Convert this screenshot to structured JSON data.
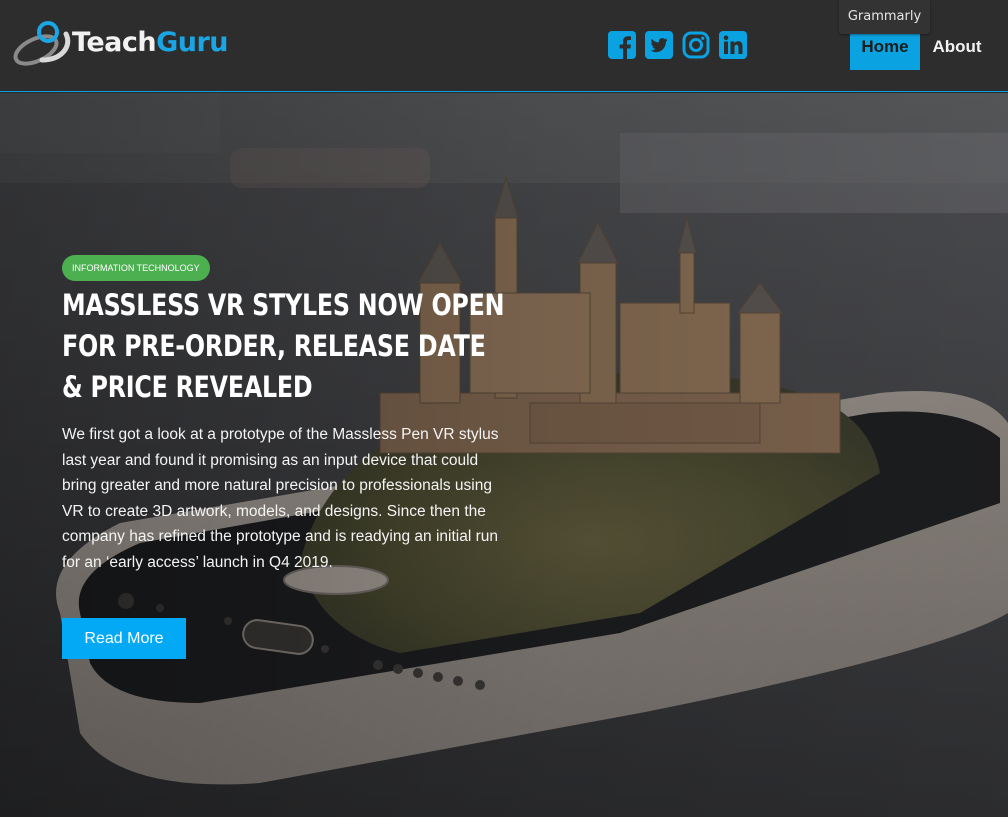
{
  "header": {
    "logo": {
      "part1": "Teach",
      "part2": "Guru"
    },
    "social": [
      "facebook-icon",
      "twitter-icon",
      "instagram-icon",
      "linkedin-icon"
    ],
    "nav": {
      "home": "Home",
      "about": "About"
    },
    "tooltip": "Grammarly"
  },
  "hero": {
    "category": "INFORMATION TECHNOLOGY",
    "title": "MASSLESS VR STYLES NOW OPEN FOR PRE-ORDER, RELEASE DATE & PRICE REVEALED",
    "excerpt": "We first got a look at a prototype of the Massless Pen VR stylus last year and found it promising as an input device that could bring greater and more natural precision to professionals using VR to create 3D artwork, models, and designs. Since then the company has refined the prototype and is readying an initial run for an ‘early access’ launch in Q4 2019.",
    "cta": "Read More"
  },
  "colors": {
    "accent": "#03a9f4",
    "badge": "#4caf50",
    "header_bg": "#2d2d2d"
  }
}
